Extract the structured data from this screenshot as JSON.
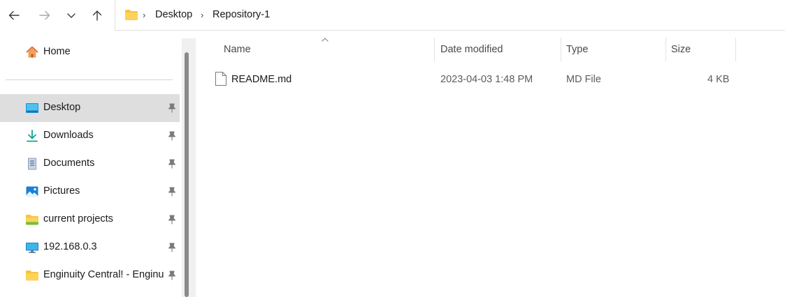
{
  "navigation": {
    "back_icon": "arrow-left-icon",
    "forward_icon": "arrow-right-icon",
    "recent_icon": "chevron-down-icon",
    "up_icon": "arrow-up-icon"
  },
  "address": {
    "crumbs": [
      "Desktop",
      "Repository-1"
    ],
    "separator": "›"
  },
  "sidebar": {
    "home": "Home",
    "items": [
      {
        "label": "Desktop",
        "icon": "desktop-icon",
        "pinned": true,
        "selected": true
      },
      {
        "label": "Downloads",
        "icon": "download-icon",
        "pinned": true
      },
      {
        "label": "Documents",
        "icon": "document-icon",
        "pinned": true
      },
      {
        "label": "Pictures",
        "icon": "pictures-icon",
        "pinned": true
      },
      {
        "label": "current projects",
        "icon": "folder-icon",
        "pinned": true
      },
      {
        "label": "192.168.0.3",
        "icon": "monitor-icon",
        "pinned": true
      },
      {
        "label": "Enginuity Central! - Enginu",
        "icon": "folder-icon",
        "pinned": true
      }
    ]
  },
  "columns": {
    "name": "Name",
    "date": "Date modified",
    "type": "Type",
    "size": "Size"
  },
  "files": [
    {
      "name": "README.md",
      "date": "2023-04-03 1:48 PM",
      "type": "MD File",
      "size": "4 KB"
    }
  ],
  "colors": {
    "folder": "#f8c33b",
    "selected_bg": "#dedede",
    "accent": "#0078d4"
  }
}
